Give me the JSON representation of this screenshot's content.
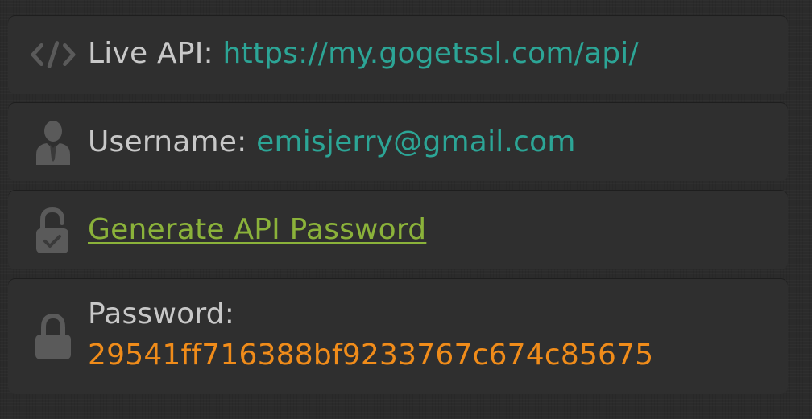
{
  "api": {
    "label": "Live API: ",
    "url": "https://my.gogetssl.com/api/",
    "icon": "code-icon"
  },
  "username": {
    "label": "Username: ",
    "value": "emisjerry@gmail.com",
    "icon": "user-icon"
  },
  "generate": {
    "link_label": "Generate API Password",
    "icon": "unlocked-padlock-icon"
  },
  "password": {
    "label": "Password:",
    "value": "29541ff716388bf9233767c674c85675",
    "icon": "padlock-icon"
  },
  "colors": {
    "background": "#2b2b2b",
    "panel": "#2f2f2f",
    "label": "#c8c8c8",
    "teal": "#2ca596",
    "link_green": "#8bb23a",
    "orange": "#f08c1a",
    "icon": "#5a5a5a"
  }
}
